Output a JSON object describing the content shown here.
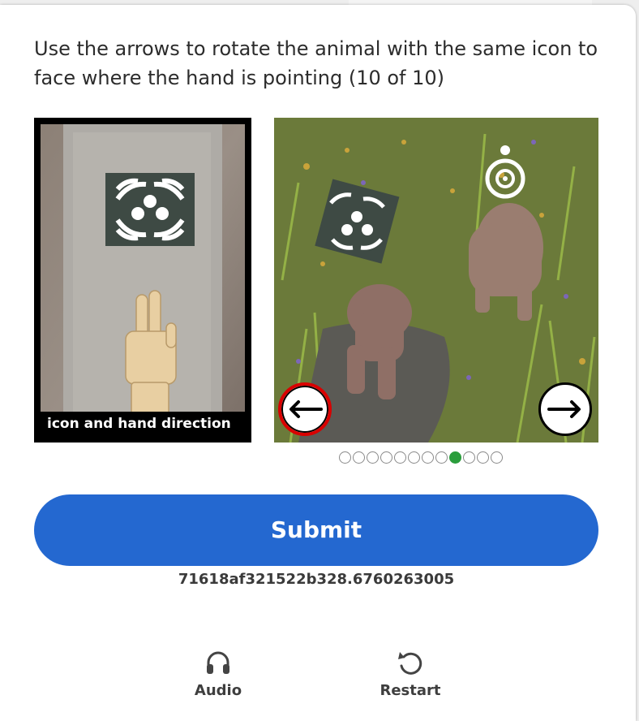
{
  "instruction": "Use the arrows to rotate the animal with the same icon to face where the hand is pointing (10 of 10)",
  "reference": {
    "caption": "icon and hand direction"
  },
  "carousel": {
    "count": 12,
    "active_index": 8
  },
  "submit_label": "Submit",
  "session_id": "71618af321522b328.6760263005",
  "footer": {
    "audio_label": "Audio",
    "restart_label": "Restart"
  },
  "colors": {
    "submit": "#2468d0",
    "active_dot": "#2a9d3c",
    "left_arrow_ring": "#d90000"
  },
  "icons": {
    "left_arrow": "arrow-left-icon",
    "right_arrow": "arrow-right-icon",
    "audio": "headphones-icon",
    "restart": "restart-icon"
  }
}
